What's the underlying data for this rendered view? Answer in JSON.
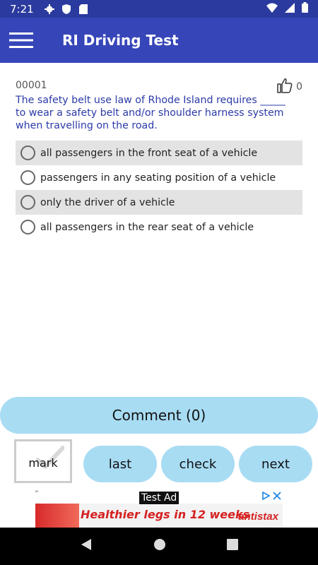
{
  "status_bar": {
    "time": "7:21",
    "icons": [
      "gear-icon",
      "shield-icon",
      "sd-card-icon",
      "wifi-icon",
      "signal-icon",
      "battery-icon"
    ]
  },
  "app_bar": {
    "title": "RI Driving Test",
    "menu_icon": "hamburger-menu-icon"
  },
  "question": {
    "id": "00001",
    "likes": "0",
    "text": "The safety belt use law of Rhode Island requires _____ to wear a safety belt and/or shoulder harness system when travelling on the road.",
    "options": [
      "all passengers in the front seat of a vehicle",
      "passengers in any seating position of a vehicle",
      "only the driver of a vehicle",
      "all passengers in the rear seat of a vehicle"
    ]
  },
  "buttons": {
    "comment": "Comment (0)",
    "mark": "mark",
    "last": "last",
    "check": "check",
    "next": "next"
  },
  "ad": {
    "quote": "\"",
    "label": "Test Ad",
    "headline": "Healthier legs in 12 weeks",
    "brand": "antistax"
  },
  "colors": {
    "status_bar": "#2b3a9e",
    "app_bar": "#3646b9",
    "button": "#a8dcf3",
    "question_text": "#2b3aa8",
    "option_shade": "#e3e3e3"
  }
}
